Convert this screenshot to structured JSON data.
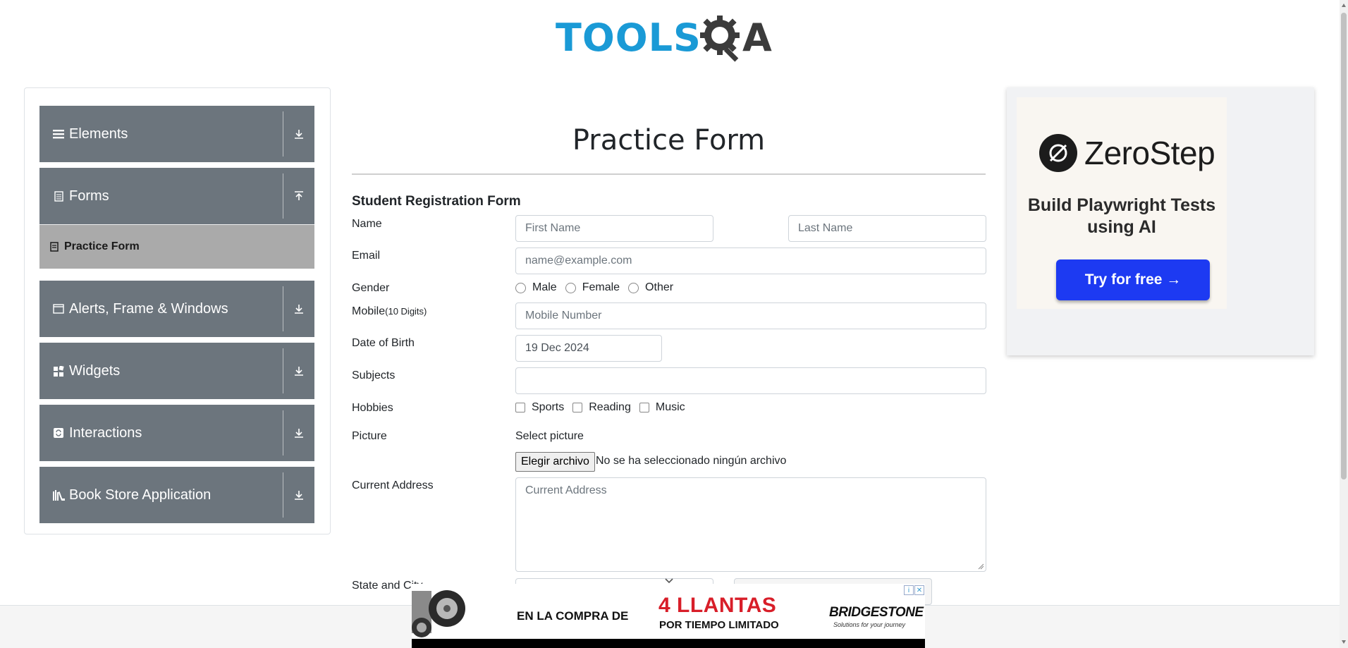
{
  "header": {
    "logo_text_a": "TOOLS",
    "logo_text_b": "A"
  },
  "sidebar": {
    "groups": [
      {
        "label": "Elements",
        "icon": "hamburger-icon",
        "arrow": "expand-down-icon"
      },
      {
        "label": "Forms",
        "icon": "document-icon",
        "arrow": "collapse-up-icon"
      },
      {
        "label": "Alerts, Frame & Windows",
        "icon": "window-icon",
        "arrow": "expand-down-icon"
      },
      {
        "label": "Widgets",
        "icon": "widget-icon",
        "arrow": "expand-down-icon"
      },
      {
        "label": "Interactions",
        "icon": "interaction-icon",
        "arrow": "expand-down-icon"
      },
      {
        "label": "Book Store Application",
        "icon": "books-icon",
        "arrow": "expand-down-icon"
      }
    ],
    "active_item": {
      "label": "Practice Form",
      "icon": "form-icon"
    }
  },
  "form": {
    "page_title": "Practice Form",
    "heading": "Student Registration Form",
    "labels": {
      "name": "Name",
      "email": "Email",
      "gender": "Gender",
      "mobile": "Mobile",
      "mobile_hint": "(10 Digits)",
      "dob": "Date of Birth",
      "subjects": "Subjects",
      "hobbies": "Hobbies",
      "picture": "Picture",
      "address": "Current Address",
      "state_city": "State and City"
    },
    "placeholders": {
      "first_name": "First Name",
      "last_name": "Last Name",
      "email": "name@example.com",
      "mobile": "Mobile Number",
      "address": "Current Address"
    },
    "dob_value": "19 Dec 2024",
    "gender_options": [
      "Male",
      "Female",
      "Other"
    ],
    "hobby_options": [
      "Sports",
      "Reading",
      "Music"
    ],
    "picture_caption": "Select picture",
    "file_button": "Elegir archivo",
    "file_status": "No se ha seleccionado ningún archivo"
  },
  "ad_right": {
    "brand": "ZeroStep",
    "tagline": "Build Playwright Tests using AI",
    "cta": "Try for free →"
  },
  "ad_bottom": {
    "left_text": "EN LA COMPRA DE",
    "big_text": "4 LLANTAS",
    "small_text": "POR TIEMPO LIMITADO",
    "brand": "BRIDGESTONE",
    "brand_sub": "Solutions for your journey"
  },
  "colors": {
    "sidebar_group": "#6c757d",
    "sidebar_active": "#aaaaaa",
    "logo_blue": "#1a9ad6",
    "cta_blue": "#1d3af2",
    "ad_red": "#d81e29"
  }
}
